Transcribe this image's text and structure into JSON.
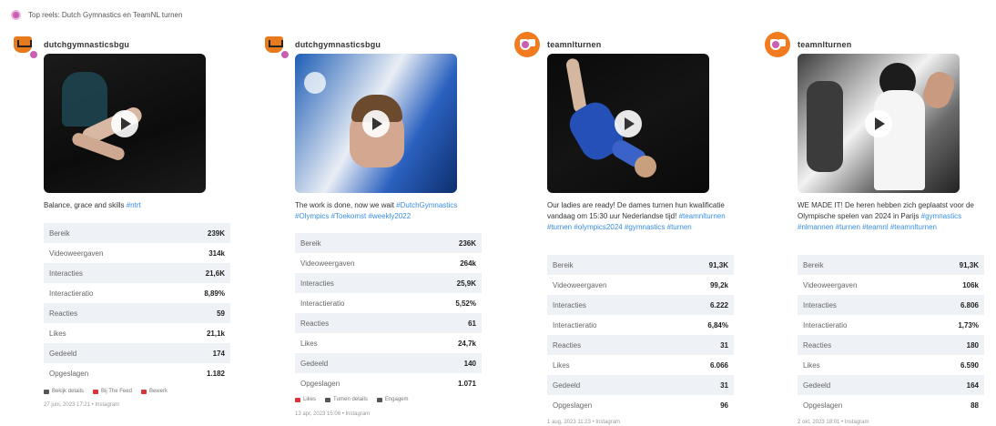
{
  "header": {
    "title": "Top reels: Dutch Gymnastics en TeamNL turnen"
  },
  "posts": [
    {
      "account": "dutchgymnasticsbgu",
      "caption": "Balance, grace and skills",
      "hashtags": "#ntrt",
      "stats": [
        {
          "label": "Bereik",
          "value": "239K"
        },
        {
          "label": "Videoweergaven",
          "value": "314k"
        },
        {
          "label": "Interacties",
          "value": "21,6K"
        },
        {
          "label": "Interactieratio",
          "value": "8,89%"
        },
        {
          "label": "Reacties",
          "value": "59"
        },
        {
          "label": "Likes",
          "value": "21,1k"
        },
        {
          "label": "Gedeeld",
          "value": "174"
        },
        {
          "label": "Opgeslagen",
          "value": "1.182"
        }
      ],
      "actions": [
        "Bekijk details",
        "Bij The Feed",
        "Bewerk"
      ],
      "date": "27 juni, 2023 17:21 • Instagram"
    },
    {
      "account": "dutchgymnasticsbgu",
      "caption": "The work is done, now we wait",
      "hashtags": "#DutchGymnastics #Olympics #Toekomst #weekly2022",
      "stats": [
        {
          "label": "Bereik",
          "value": "236K"
        },
        {
          "label": "Videoweergaven",
          "value": "264k"
        },
        {
          "label": "Interacties",
          "value": "25,9K"
        },
        {
          "label": "Interactieratio",
          "value": "5,52%"
        },
        {
          "label": "Reacties",
          "value": "61"
        },
        {
          "label": "Likes",
          "value": "24,7k"
        },
        {
          "label": "Gedeeld",
          "value": "140"
        },
        {
          "label": "Opgeslagen",
          "value": "1.071"
        }
      ],
      "actions": [
        "Likes",
        "Turnen details",
        "Engagem"
      ],
      "date": "13 apr, 2023 15:06 • Instagram"
    },
    {
      "account": "teamnlturnen",
      "caption": "Our ladies are ready! De dames turnen hun kwalificatie vandaag om 15:30 uur Nederlandse tijd!",
      "hashtags": "#teamnlturnen #turnen #olympics2024 #gymnastics #turnen",
      "stats": [
        {
          "label": "Bereik",
          "value": "91,3K"
        },
        {
          "label": "Videoweergaven",
          "value": "99,2k"
        },
        {
          "label": "Interacties",
          "value": "6.222"
        },
        {
          "label": "Interactieratio",
          "value": "6,84%"
        },
        {
          "label": "Reacties",
          "value": "31"
        },
        {
          "label": "Likes",
          "value": "6.066"
        },
        {
          "label": "Gedeeld",
          "value": "31"
        },
        {
          "label": "Opgeslagen",
          "value": "96"
        }
      ],
      "actions": [],
      "date": "1 aug, 2023 11:23 • Instagram"
    },
    {
      "account": "teamnlturnen",
      "caption": "WE MADE IT! De heren hebben zich geplaatst voor de Olympische spelen van 2024 in Parijs",
      "hashtags": "#gymnastics #nlmannen #turnen #teamnl #teamnlturnen",
      "stats": [
        {
          "label": "Bereik",
          "value": "91,3K"
        },
        {
          "label": "Videoweergaven",
          "value": "106k"
        },
        {
          "label": "Interacties",
          "value": "6.806"
        },
        {
          "label": "Interactieratio",
          "value": "1,73%"
        },
        {
          "label": "Reacties",
          "value": "180"
        },
        {
          "label": "Likes",
          "value": "6.590"
        },
        {
          "label": "Gedeeld",
          "value": "164"
        },
        {
          "label": "Opgeslagen",
          "value": "88"
        }
      ],
      "actions": [],
      "date": "2 okt, 2023 18:01 • Instagram"
    }
  ]
}
